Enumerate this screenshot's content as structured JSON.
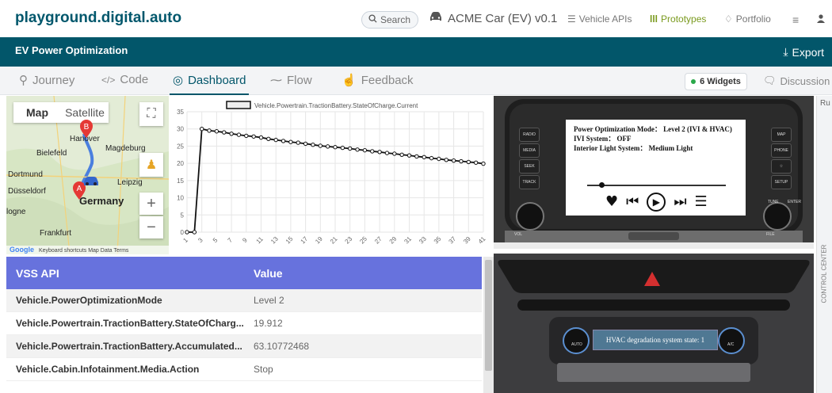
{
  "header": {
    "logo": "playground.digital.auto",
    "search_label": "Search",
    "car_name": "ACME Car (EV) v0.1",
    "nav": [
      {
        "label": "Vehicle APIs",
        "icon": "list-icon"
      },
      {
        "label": "Prototypes",
        "icon": "prototype-icon"
      },
      {
        "label": "Portfolio",
        "icon": "portfolio-icon"
      }
    ]
  },
  "titlebar": {
    "title": "EV Power Optimization",
    "export_label": "Export"
  },
  "tabs": {
    "items": [
      {
        "label": "Journey",
        "icon": "journey-icon"
      },
      {
        "label": "Code",
        "icon": "code-icon"
      },
      {
        "label": "Dashboard",
        "icon": "dashboard-icon"
      },
      {
        "label": "Flow",
        "icon": "flow-icon"
      },
      {
        "label": "Feedback",
        "icon": "thumb-up-icon"
      }
    ],
    "active": "Dashboard",
    "widgets_badge": "6 Widgets",
    "discussion": "Discussion"
  },
  "map": {
    "type_map": "Map",
    "type_satellite": "Satellite",
    "cities": [
      "Hanover",
      "Bielefeld",
      "Magdeburg",
      "Dortmund",
      "Düsseldorf",
      "Leipzig",
      "Germany",
      "Frankfurt",
      "logne"
    ],
    "marker_a": "A",
    "marker_b": "B",
    "footer": "Keyboard shortcuts   Map Data   Terms",
    "google": "Google"
  },
  "chart_data": {
    "type": "line",
    "title": "",
    "legend": [
      "Vehicle.Powertrain.TractionBattery.StateOfCharge.Current"
    ],
    "x": [
      1,
      2,
      3,
      4,
      5,
      6,
      7,
      8,
      9,
      10,
      11,
      12,
      13,
      14,
      15,
      16,
      17,
      18,
      19,
      20,
      21,
      22,
      23,
      24,
      25,
      26,
      27,
      28,
      29,
      30,
      31,
      32,
      33,
      34,
      35,
      36,
      37,
      38,
      39,
      40,
      41
    ],
    "x_tick_labels": [
      "1",
      "3",
      "5",
      "7",
      "9",
      "11",
      "13",
      "15",
      "17",
      "19",
      "21",
      "23",
      "25",
      "27",
      "29",
      "31",
      "33",
      "35",
      "37",
      "39",
      "41"
    ],
    "series": [
      {
        "name": "Vehicle.Powertrain.TractionBattery.StateOfCharge.Current",
        "values": [
          0,
          0,
          30,
          29.5,
          29.3,
          29,
          28.6,
          28.3,
          28,
          27.8,
          27.5,
          27.1,
          26.8,
          26.5,
          26.2,
          26,
          25.7,
          25.4,
          25.1,
          24.9,
          24.7,
          24.5,
          24.3,
          24,
          23.8,
          23.5,
          23.3,
          23,
          22.8,
          22.5,
          22.3,
          22,
          21.8,
          21.5,
          21.3,
          21,
          20.8,
          20.6,
          20.4,
          20.2,
          19.9
        ]
      }
    ],
    "ylim": [
      0,
      35
    ],
    "y_ticks": [
      0,
      5,
      10,
      15,
      20,
      25,
      30,
      35
    ],
    "grid": true,
    "legend_position": "top"
  },
  "vss": {
    "col_api": "VSS API",
    "col_value": "Value",
    "rows": [
      {
        "api": "Vehicle.PowerOptimizationMode",
        "value": "Level 2"
      },
      {
        "api": "Vehicle.Powertrain.TractionBattery.StateOfCharg...",
        "value": "19.912"
      },
      {
        "api": "Vehicle.Powertrain.TractionBattery.Accumulated...",
        "value": "63.10772468"
      },
      {
        "api": "Vehicle.Cabin.Infotainment.Media.Action",
        "value": "Stop"
      }
    ]
  },
  "infotainment": {
    "line1": "Power Optimization Mode： Level 2 (IVI & HVAC)",
    "line2": "IVI System： OFF",
    "line3": "Interior Light System： Medium Light",
    "left_buttons": [
      "RADIO",
      "MEDIA",
      "SEEK",
      "TRACK"
    ],
    "right_buttons": [
      "MAP",
      "PHONE",
      "☆",
      "SETUP"
    ],
    "knob_left": "VOL",
    "knob_right": "FILE",
    "tune": "TUNE",
    "enter": "ENTER"
  },
  "hvac": {
    "status": "HVAC degradation system state: 1",
    "auto": "AUTO",
    "ac": "A/C"
  },
  "right_strip": {
    "run": "Ru",
    "control_center": "CONTROL CENTER"
  }
}
